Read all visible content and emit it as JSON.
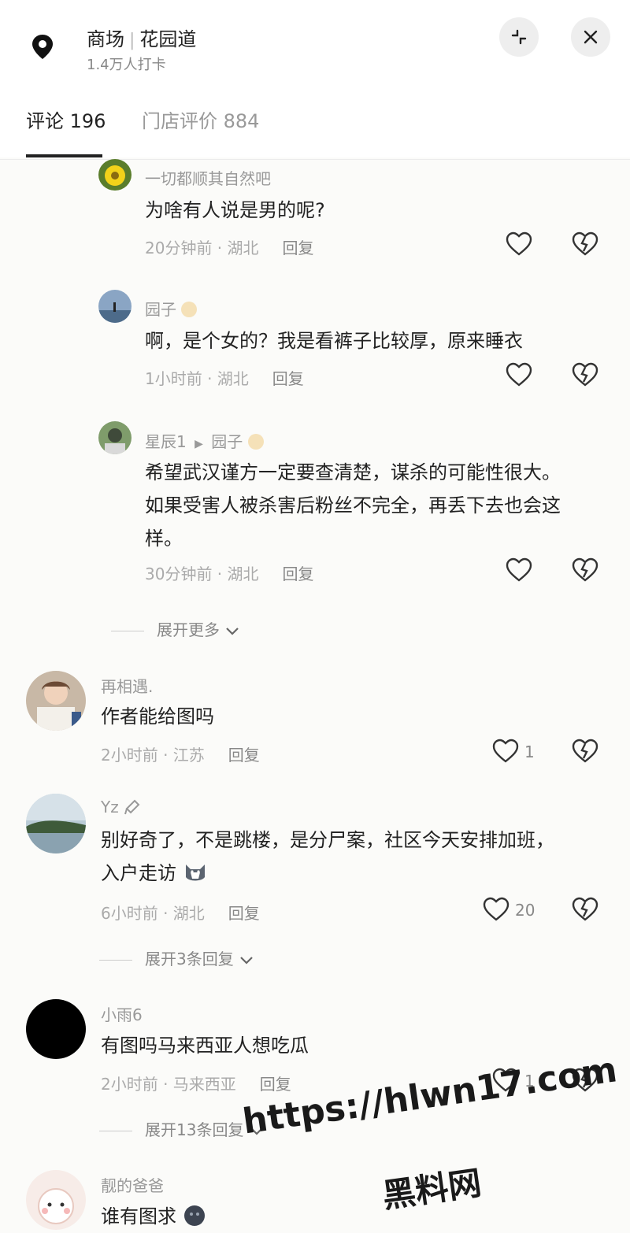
{
  "header": {
    "place": "商场",
    "place_detail": "花园道",
    "checkins": "1.4万人打卡"
  },
  "tabs": [
    {
      "label": "评论 196"
    },
    {
      "label": "门店评价 884"
    }
  ],
  "comments": [
    {
      "user": "一切都顺其自然吧",
      "text": "为啥有人说是男的呢?",
      "time": "20分钟前 · 湖北",
      "reply": "回复"
    },
    {
      "user": "园子",
      "text": "啊，是个女的？我是看裤子比较厚，原来睡衣",
      "time": "1小时前 · 湖北",
      "reply": "回复"
    },
    {
      "user": "星辰1",
      "reply_to": "园子",
      "text_1": "希望武汉谨方一定要查清楚，谋杀的可能性很大。",
      "text_2": "如果受害人被杀害后粉丝不完全，再丢下去也会这",
      "text_3": "样。",
      "time": "30分钟前 · 湖北",
      "reply": "回复"
    },
    {
      "expand": "展开更多"
    },
    {
      "user": "再相遇.",
      "text": "作者能给图吗",
      "time": "2小时前 · 江苏",
      "reply": "回复",
      "likes": "1"
    },
    {
      "user": "Yz",
      "text_1": "别好奇了，不是跳楼，是分尸案，社区今天安排加班，",
      "text_2": "入户走访",
      "time": "6小时前 · 湖北",
      "reply": "回复",
      "likes": "20",
      "expand": "展开3条回复"
    },
    {
      "user": "小雨6",
      "text": "有图吗马来西亚人想吃瓜",
      "time": "2小时前 · 马来西亚",
      "reply": "回复",
      "likes": "1",
      "expand": "展开13条回复"
    },
    {
      "user": "靓的爸爸",
      "text": "谁有图求"
    }
  ],
  "watermark": {
    "line1": "https://hlwn17.com",
    "line2": "黑料网"
  },
  "colors": {
    "background": "#fbfbf9",
    "text": "#222222",
    "muted": "#999999"
  }
}
